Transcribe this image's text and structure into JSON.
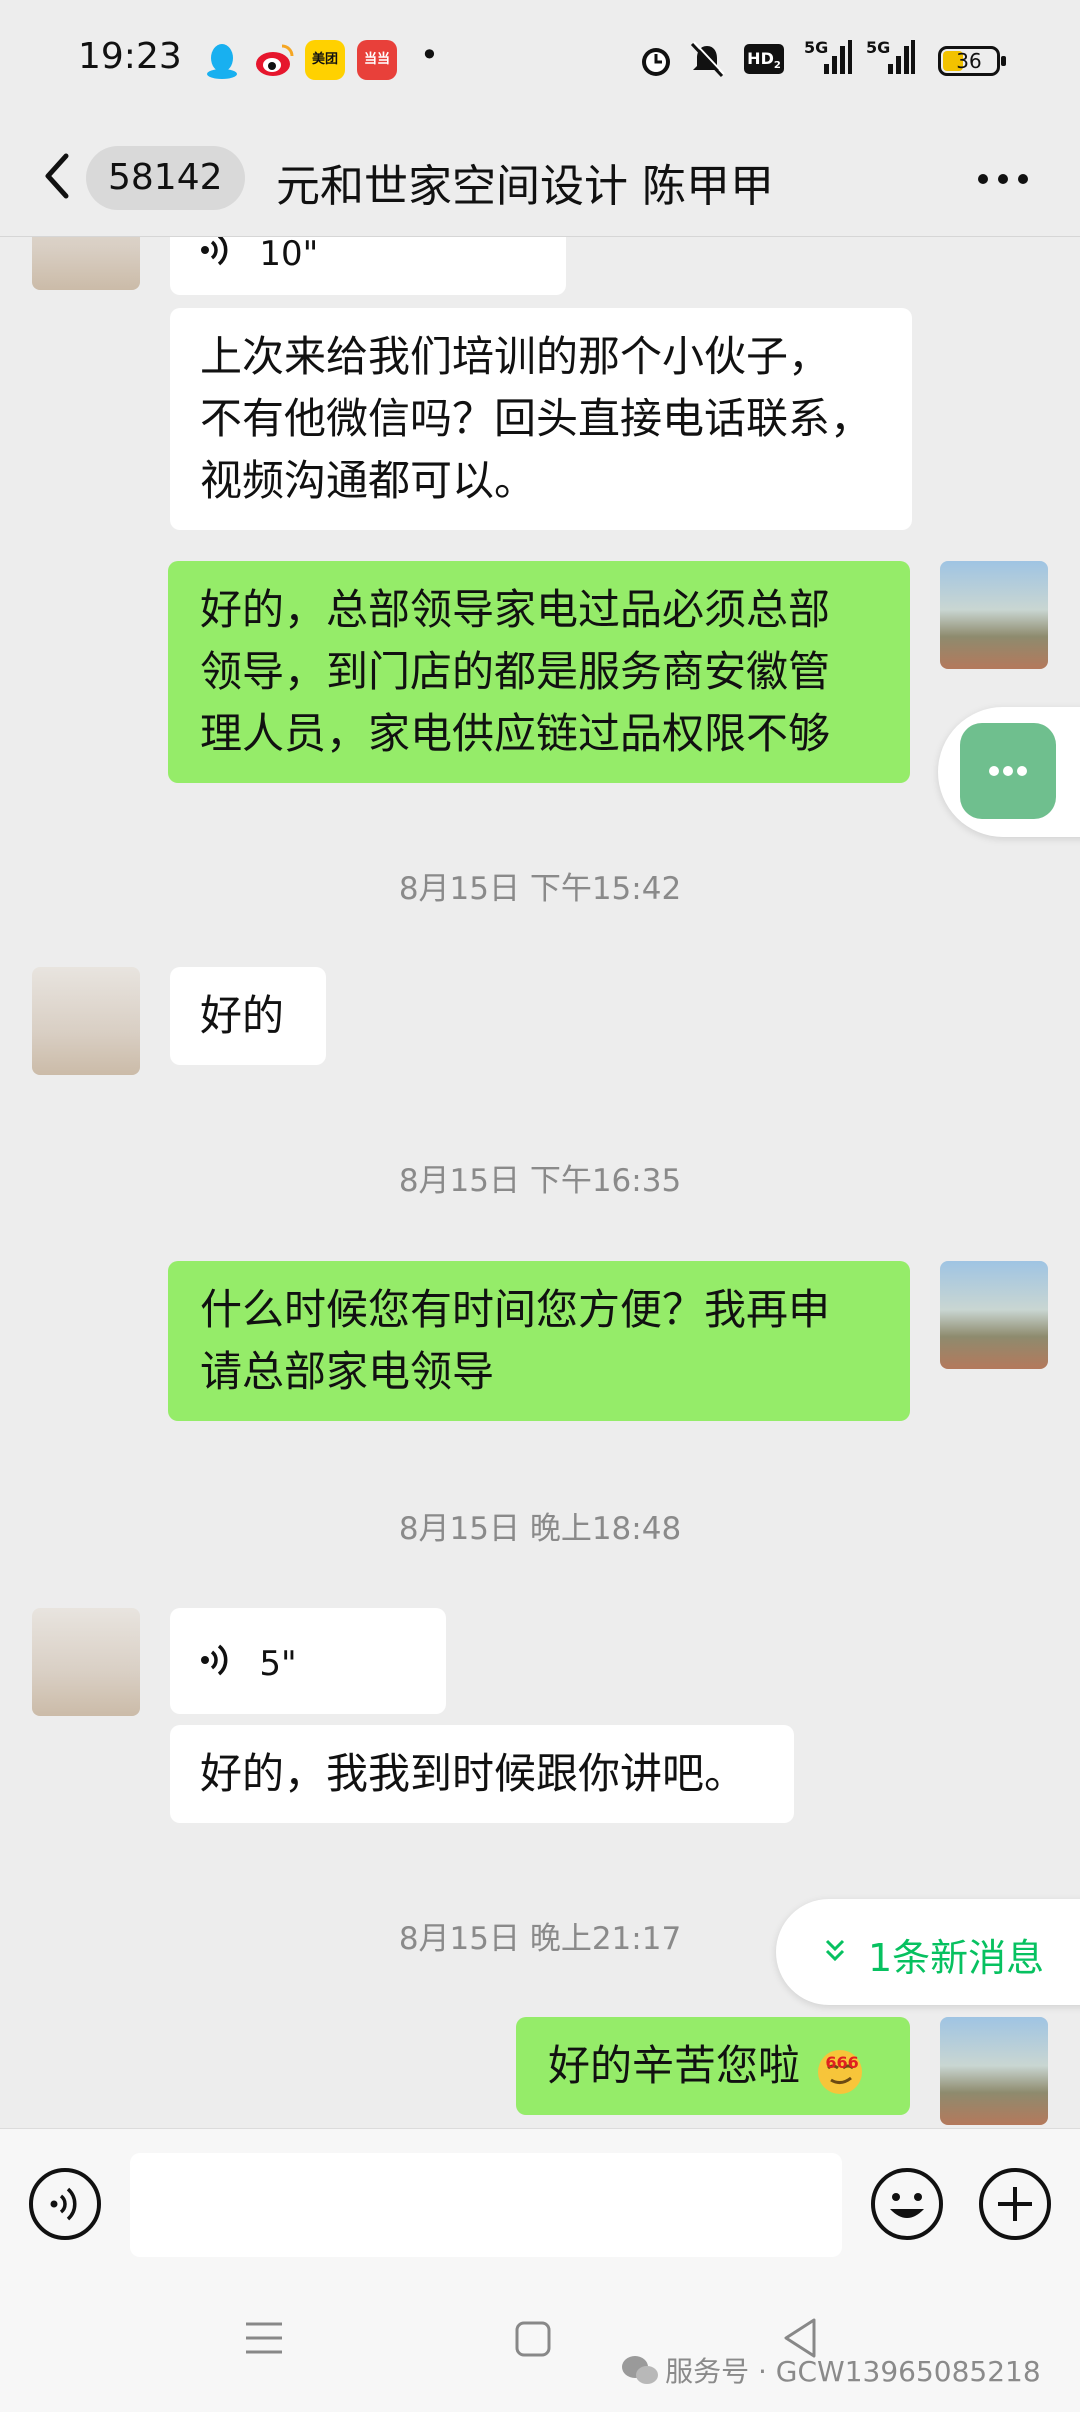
{
  "status_bar": {
    "time": "19:23",
    "app_icons": [
      "qq-icon",
      "weibo-icon",
      "meituan-icon",
      "dangdang-icon"
    ],
    "meituan_label": "美团",
    "dangdang_label": "当当",
    "dot": "•",
    "hd_label": "HD",
    "hd_sub": "2",
    "signal1_label": "5G",
    "signal2_label": "5G",
    "battery": "36"
  },
  "header": {
    "unread_count": "58142",
    "title": "元和世家空间设计 陈甲甲"
  },
  "messages": [
    {
      "type": "voice",
      "side": "left",
      "duration": "10\""
    },
    {
      "type": "text",
      "side": "left",
      "lines": [
        "上次来给我们培训的那个小伙子，",
        "不有他微信吗？回头直接电话联系，",
        "视频沟通都可以。"
      ]
    },
    {
      "type": "text",
      "side": "right",
      "lines": [
        "好的，总部领导家电过品必须总部",
        "领导，到门店的都是服务商安徽管",
        "理人员，家电供应链过品权限不够"
      ]
    },
    {
      "type": "timestamp",
      "text": "8月15日 下午15:42"
    },
    {
      "type": "text",
      "side": "left",
      "lines": [
        "好的"
      ]
    },
    {
      "type": "timestamp",
      "text": "8月15日 下午16:35"
    },
    {
      "type": "text",
      "side": "right",
      "lines": [
        "什么时候您有时间您方便？我再申",
        "请总部家电领导"
      ]
    },
    {
      "type": "timestamp",
      "text": "8月15日 晚上18:48"
    },
    {
      "type": "voice",
      "side": "left",
      "duration": "5\""
    },
    {
      "type": "text",
      "side": "left",
      "lines": [
        "好的，我我到时候跟你讲吧。"
      ]
    },
    {
      "type": "timestamp",
      "text": "8月15日 晚上21:17"
    },
    {
      "type": "text",
      "side": "right",
      "lines": [
        "好的辛苦您啦"
      ],
      "emoji": "666"
    }
  ],
  "new_message_pill": "1条新消息",
  "watermark": "服务号 · GCW13965085218",
  "colors": {
    "right_bubble": "#95ec69",
    "left_bubble": "#ffffff",
    "accent_green": "#07c160",
    "background": "#ededed"
  }
}
